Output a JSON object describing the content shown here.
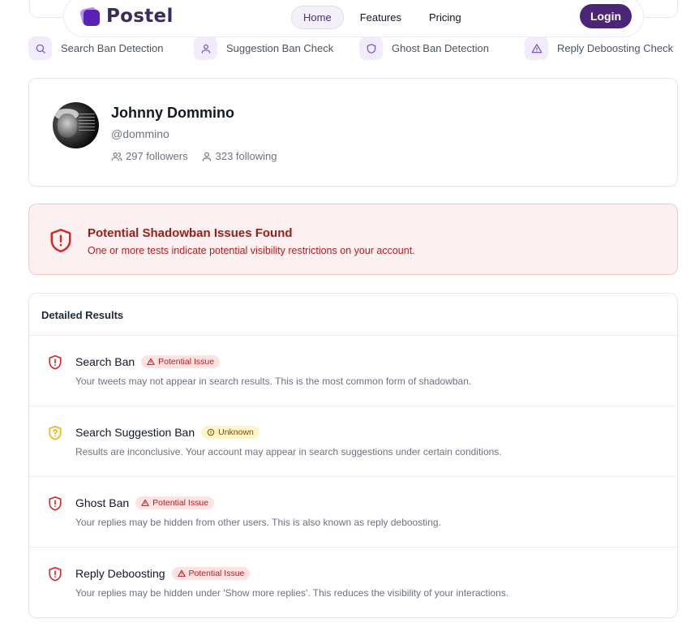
{
  "nav": {
    "logo_text": "Postel",
    "links": [
      {
        "label": "Home",
        "active": true
      },
      {
        "label": "Features",
        "active": false
      },
      {
        "label": "Pricing",
        "active": false
      }
    ],
    "login_label": "Login",
    "accent": "#4b2677"
  },
  "features": [
    {
      "label": "Search Ban Detection",
      "icon": "search-icon"
    },
    {
      "label": "Suggestion Ban Check",
      "icon": "user-icon"
    },
    {
      "label": "Ghost Ban Detection",
      "icon": "shield-icon"
    },
    {
      "label": "Reply Deboosting Check",
      "icon": "warning-icon"
    }
  ],
  "profile": {
    "name": "Johnny Dommino",
    "handle": "@dommino",
    "followers": "297 followers",
    "following": "323 following"
  },
  "alert": {
    "title": "Potential Shadowban Issues Found",
    "message": "One or more tests indicate potential visibility restrictions on your account.",
    "color": "#dc2626"
  },
  "results": {
    "heading": "Detailed Results",
    "items": [
      {
        "title": "Search Ban",
        "status": "Potential Issue",
        "status_type": "issue",
        "description": "Your tweets may not appear in search results. This is the most common form of shadowban."
      },
      {
        "title": "Search Suggestion Ban",
        "status": "Unknown",
        "status_type": "unknown",
        "description": "Results are inconclusive. Your account may appear in search suggestions under certain conditions."
      },
      {
        "title": "Ghost Ban",
        "status": "Potential Issue",
        "status_type": "issue",
        "description": "Your replies may be hidden from other users. This is also known as reply deboosting."
      },
      {
        "title": "Reply Deboosting",
        "status": "Potential Issue",
        "status_type": "issue",
        "description": "Your replies may be hidden under 'Show more replies'. This reduces the visibility of your interactions."
      }
    ]
  }
}
